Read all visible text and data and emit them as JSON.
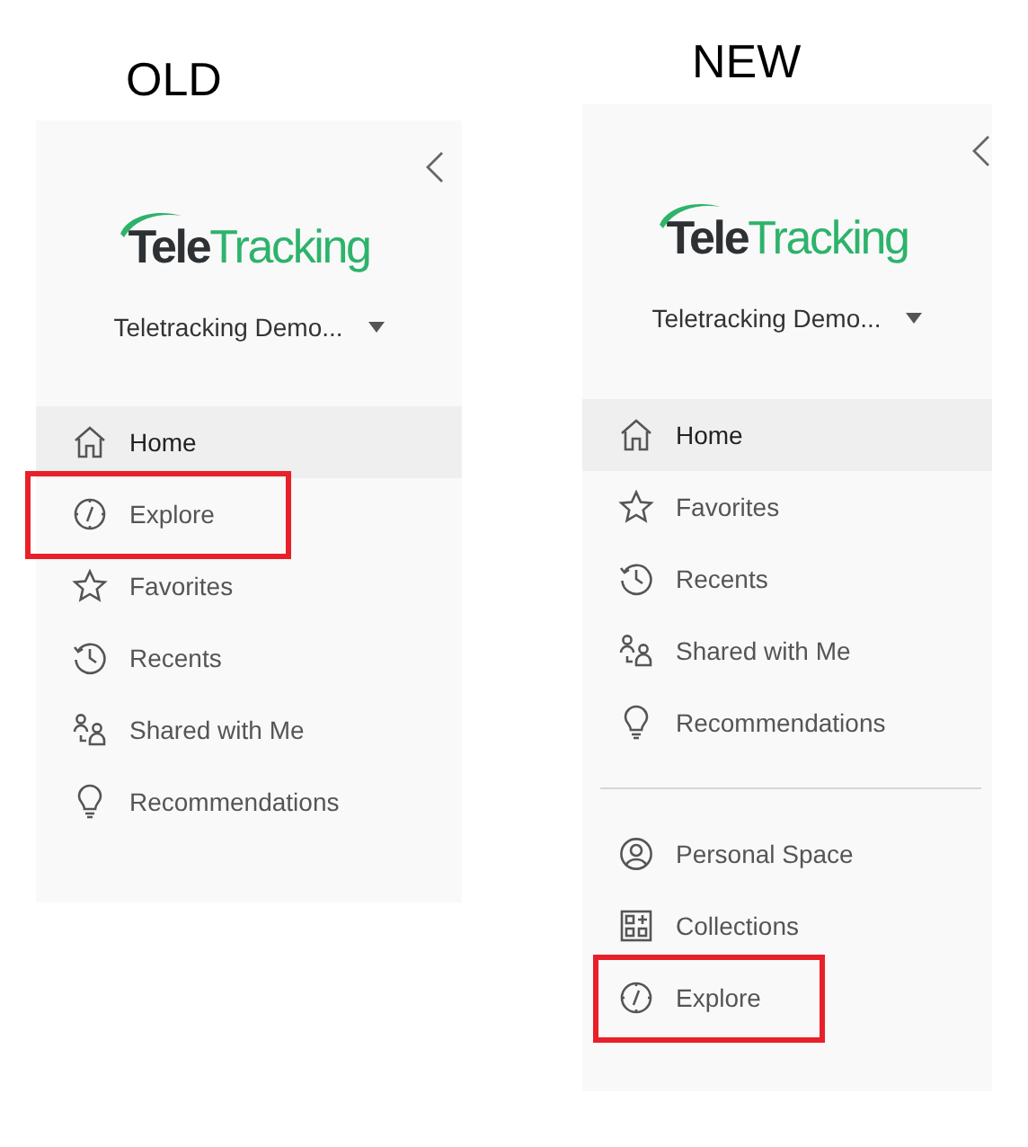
{
  "panels": [
    {
      "heading": "OLD",
      "logo": {
        "first": "Tele",
        "second": "Tracking"
      },
      "site": "Teletracking Demo...",
      "sections": [
        {
          "items": [
            {
              "label": "Home",
              "kind": "home",
              "selected": true,
              "highlighted": false
            },
            {
              "label": "Explore",
              "kind": "compass",
              "selected": false,
              "highlighted": true
            },
            {
              "label": "Favorites",
              "kind": "star",
              "selected": false,
              "highlighted": false
            },
            {
              "label": "Recents",
              "kind": "clock",
              "selected": false,
              "highlighted": false
            },
            {
              "label": "Shared with Me",
              "kind": "shared",
              "selected": false,
              "highlighted": false
            },
            {
              "label": "Recommendations",
              "kind": "bulb",
              "selected": false,
              "highlighted": false
            }
          ]
        }
      ]
    },
    {
      "heading": "NEW",
      "logo": {
        "first": "Tele",
        "second": "Tracking"
      },
      "site": "Teletracking Demo...",
      "sections": [
        {
          "items": [
            {
              "label": "Home",
              "kind": "home",
              "selected": true,
              "highlighted": false
            },
            {
              "label": "Favorites",
              "kind": "star",
              "selected": false,
              "highlighted": false
            },
            {
              "label": "Recents",
              "kind": "clock",
              "selected": false,
              "highlighted": false
            },
            {
              "label": "Shared with Me",
              "kind": "shared",
              "selected": false,
              "highlighted": false
            },
            {
              "label": "Recommendations",
              "kind": "bulb",
              "selected": false,
              "highlighted": false
            }
          ]
        },
        {
          "items": [
            {
              "label": "Personal Space",
              "kind": "person",
              "selected": false,
              "highlighted": false
            },
            {
              "label": "Collections",
              "kind": "grid",
              "selected": false,
              "highlighted": false
            },
            {
              "label": "Explore",
              "kind": "compass",
              "selected": false,
              "highlighted": true
            }
          ]
        }
      ]
    }
  ]
}
